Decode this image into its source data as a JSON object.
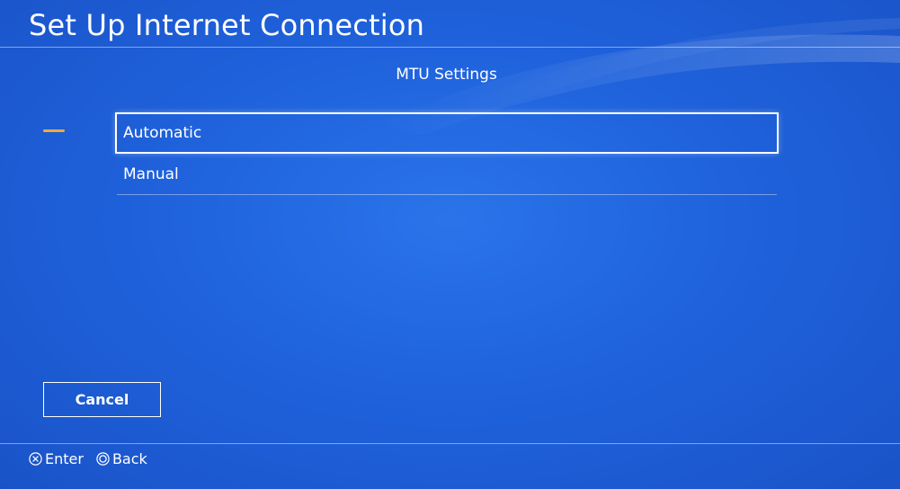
{
  "header": {
    "title": "Set Up Internet Connection",
    "subtitle": "MTU Settings"
  },
  "menu": {
    "items": [
      {
        "label": "Automatic",
        "selected": true
      },
      {
        "label": "Manual",
        "selected": false
      }
    ]
  },
  "buttons": {
    "cancel_label": "Cancel"
  },
  "footer": {
    "hints": [
      {
        "icon": "cross-button-icon",
        "label": "Enter"
      },
      {
        "icon": "circle-button-icon",
        "label": "Back"
      }
    ]
  },
  "colors": {
    "background": "#1c5fd6",
    "accent_indicator": "#f2a93b",
    "text": "#ffffff"
  }
}
